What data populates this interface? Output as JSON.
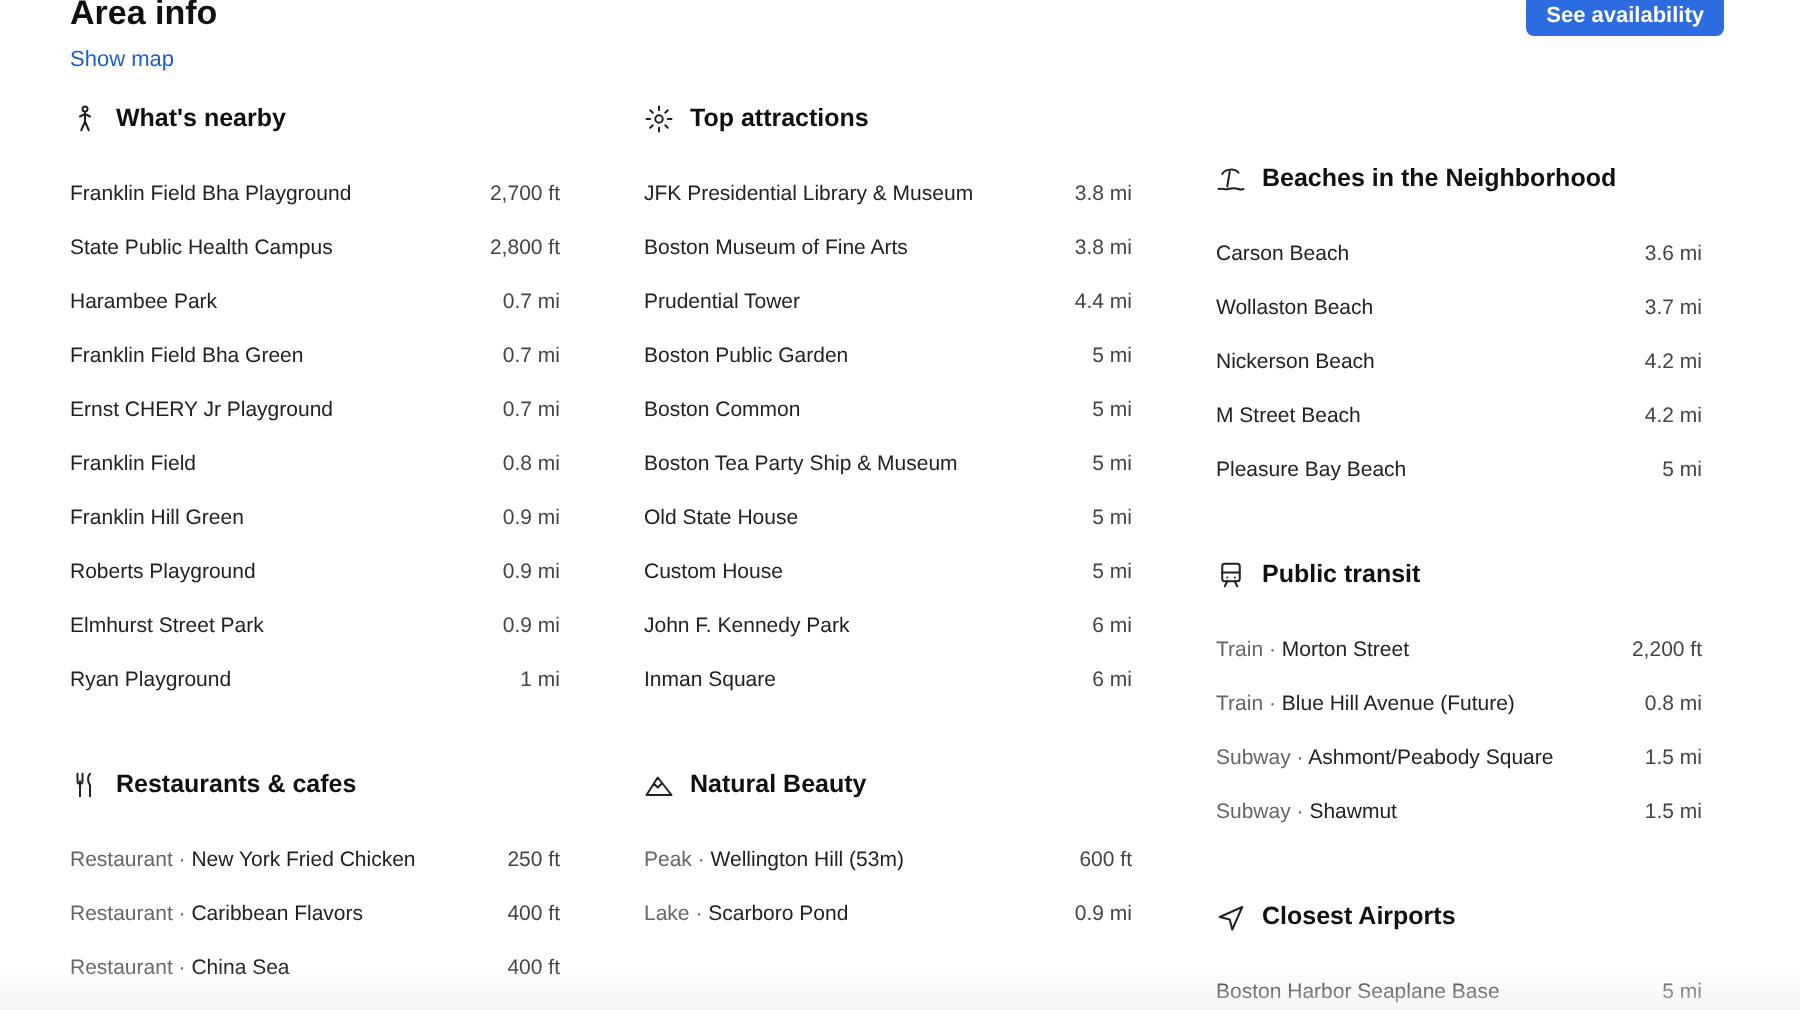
{
  "title": "Area info",
  "show_map": "Show map",
  "availability_button": "See availability",
  "separator": "·",
  "columns": [
    [
      {
        "kind": "nearby",
        "heading": "What's nearby",
        "items": [
          {
            "name": "Franklin Field Bha Playground",
            "distance": "2,700 ft"
          },
          {
            "name": "State Public Health Campus",
            "distance": "2,800 ft"
          },
          {
            "name": "Harambee Park",
            "distance": "0.7 mi"
          },
          {
            "name": "Franklin Field Bha Green",
            "distance": "0.7 mi"
          },
          {
            "name": "Ernst CHERY Jr Playground",
            "distance": "0.7 mi"
          },
          {
            "name": "Franklin Field",
            "distance": "0.8 mi"
          },
          {
            "name": "Franklin Hill Green",
            "distance": "0.9 mi"
          },
          {
            "name": "Roberts Playground",
            "distance": "0.9 mi"
          },
          {
            "name": "Elmhurst Street Park",
            "distance": "0.9 mi"
          },
          {
            "name": "Ryan Playground",
            "distance": "1 mi"
          }
        ]
      },
      {
        "kind": "restaurants",
        "heading": "Restaurants & cafes",
        "items": [
          {
            "category": "Restaurant",
            "name": "New York Fried Chicken",
            "distance": "250 ft"
          },
          {
            "category": "Restaurant",
            "name": "Caribbean Flavors",
            "distance": "400 ft"
          },
          {
            "category": "Restaurant",
            "name": "China Sea",
            "distance": "400 ft"
          }
        ]
      }
    ],
    [
      {
        "kind": "attractions",
        "heading": "Top attractions",
        "items": [
          {
            "name": "JFK Presidential Library & Museum",
            "distance": "3.8 mi"
          },
          {
            "name": "Boston Museum of Fine Arts",
            "distance": "3.8 mi"
          },
          {
            "name": "Prudential Tower",
            "distance": "4.4 mi"
          },
          {
            "name": "Boston Public Garden",
            "distance": "5 mi"
          },
          {
            "name": "Boston Common",
            "distance": "5 mi"
          },
          {
            "name": "Boston Tea Party Ship & Museum",
            "distance": "5 mi"
          },
          {
            "name": "Old State House",
            "distance": "5 mi"
          },
          {
            "name": "Custom House",
            "distance": "5 mi"
          },
          {
            "name": "John F. Kennedy Park",
            "distance": "6 mi"
          },
          {
            "name": "Inman Square",
            "distance": "6 mi"
          }
        ]
      },
      {
        "kind": "nature",
        "heading": "Natural Beauty",
        "items": [
          {
            "category": "Peak",
            "name": "Wellington Hill (53m)",
            "distance": "600 ft"
          },
          {
            "category": "Lake",
            "name": "Scarboro Pond",
            "distance": "0.9 mi"
          }
        ]
      }
    ],
    [
      {
        "kind": "beaches",
        "heading": "Beaches in the Neighborhood",
        "items": [
          {
            "name": "Carson Beach",
            "distance": "3.6 mi"
          },
          {
            "name": "Wollaston Beach",
            "distance": "3.7 mi"
          },
          {
            "name": "Nickerson Beach",
            "distance": "4.2 mi"
          },
          {
            "name": "M Street Beach",
            "distance": "4.2 mi"
          },
          {
            "name": "Pleasure Bay Beach",
            "distance": "5 mi"
          }
        ]
      },
      {
        "kind": "transit",
        "heading": "Public transit",
        "items": [
          {
            "category": "Train",
            "name": "Morton Street",
            "distance": "2,200 ft"
          },
          {
            "category": "Train",
            "name": "Blue Hill Avenue (Future)",
            "distance": "0.8 mi"
          },
          {
            "category": "Subway",
            "name": "Ashmont/Peabody Square",
            "distance": "1.5 mi"
          },
          {
            "category": "Subway",
            "name": "Shawmut",
            "distance": "1.5 mi"
          }
        ]
      },
      {
        "kind": "airports",
        "heading": "Closest Airports",
        "items": [
          {
            "name": "Boston Harbor Seaplane Base",
            "distance": "5 mi"
          }
        ]
      }
    ]
  ]
}
